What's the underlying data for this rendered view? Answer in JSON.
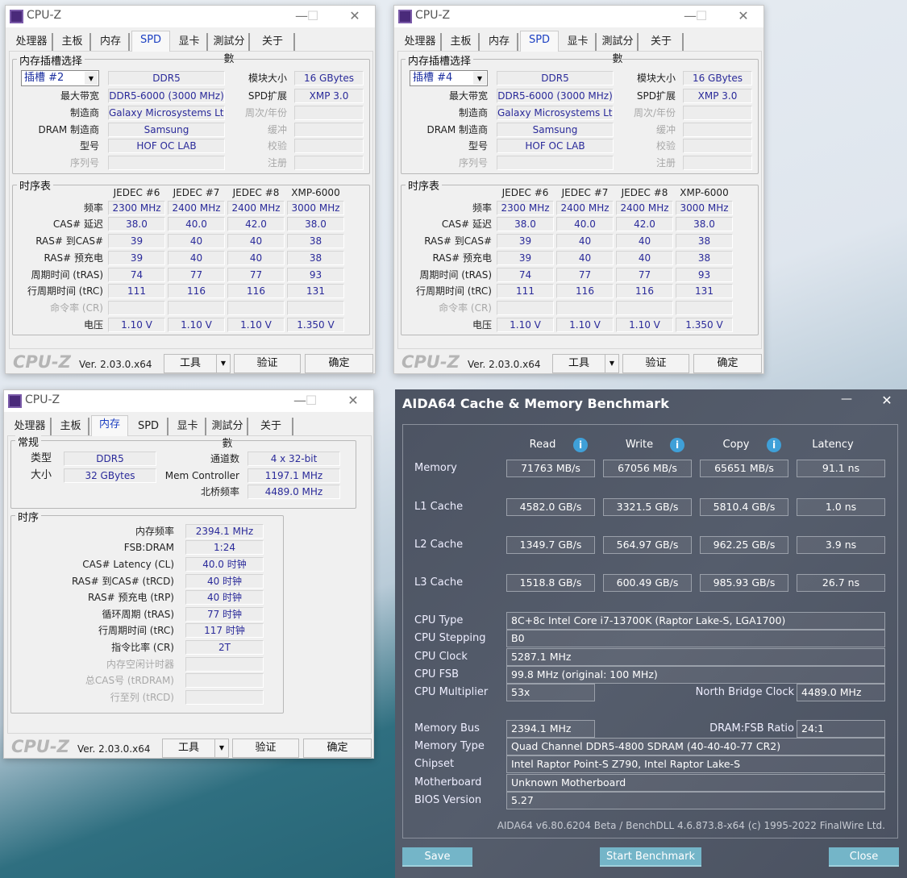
{
  "spd_windows": [
    {
      "title": "CPU-Z",
      "tabs": [
        "处理器",
        "主板",
        "内存",
        "SPD",
        "显卡",
        "測試分數",
        "关于"
      ],
      "active_tab": "SPD",
      "slot_group": "内存插槽选择",
      "slot": "插槽 #2",
      "left": [
        {
          "label": "",
          "value": "DDR5"
        },
        {
          "label": "最大带宽",
          "value": "DDR5-6000 (3000 MHz)"
        },
        {
          "label": "制造商",
          "value": "Galaxy Microsystems Ltd."
        },
        {
          "label": "DRAM 制造商",
          "value": "Samsung"
        },
        {
          "label": "型号",
          "value": "HOF OC LAB"
        },
        {
          "label": "序列号",
          "value": "",
          "disabled": true
        }
      ],
      "right": [
        {
          "label": "模块大小",
          "value": "16 GBytes"
        },
        {
          "label": "SPD扩展",
          "value": "XMP 3.0"
        },
        {
          "label": "周次/年份",
          "value": "",
          "disabled": true
        },
        {
          "label": "缓冲",
          "value": "",
          "disabled": true
        },
        {
          "label": "校验",
          "value": "",
          "disabled": true
        },
        {
          "label": "注册",
          "value": "",
          "disabled": true
        }
      ],
      "timing_group": "时序表",
      "timing_headers": [
        "JEDEC #6",
        "JEDEC #7",
        "JEDEC #8",
        "XMP-6000"
      ],
      "timing_rows": [
        {
          "label": "频率",
          "values": [
            "2300 MHz",
            "2400 MHz",
            "2400 MHz",
            "3000 MHz"
          ]
        },
        {
          "label": "CAS# 延迟",
          "values": [
            "38.0",
            "40.0",
            "42.0",
            "38.0"
          ]
        },
        {
          "label": "RAS# 到CAS#",
          "values": [
            "39",
            "40",
            "40",
            "38"
          ]
        },
        {
          "label": "RAS# 预充电",
          "values": [
            "39",
            "40",
            "40",
            "38"
          ]
        },
        {
          "label": "周期时间 (tRAS)",
          "values": [
            "74",
            "77",
            "77",
            "93"
          ]
        },
        {
          "label": "行周期时间 (tRC)",
          "values": [
            "111",
            "116",
            "116",
            "131"
          ]
        },
        {
          "label": "命令率 (CR)",
          "values": [
            "",
            "",
            "",
            ""
          ],
          "disabled": true
        },
        {
          "label": "电压",
          "values": [
            "1.10 V",
            "1.10 V",
            "1.10 V",
            "1.350 V"
          ]
        }
      ],
      "footer": {
        "logo": "CPU-Z",
        "version": "Ver. 2.03.0.x64",
        "tools": "工具",
        "validate": "验证",
        "ok": "确定"
      }
    },
    {
      "title": "CPU-Z",
      "tabs": [
        "处理器",
        "主板",
        "内存",
        "SPD",
        "显卡",
        "測試分數",
        "关于"
      ],
      "active_tab": "SPD",
      "slot_group": "内存插槽选择",
      "slot": "插槽 #4",
      "left": [
        {
          "label": "",
          "value": "DDR5"
        },
        {
          "label": "最大带宽",
          "value": "DDR5-6000 (3000 MHz)"
        },
        {
          "label": "制造商",
          "value": "Galaxy Microsystems Ltd."
        },
        {
          "label": "DRAM 制造商",
          "value": "Samsung"
        },
        {
          "label": "型号",
          "value": "HOF OC LAB"
        },
        {
          "label": "序列号",
          "value": "",
          "disabled": true
        }
      ],
      "right": [
        {
          "label": "模块大小",
          "value": "16 GBytes"
        },
        {
          "label": "SPD扩展",
          "value": "XMP 3.0"
        },
        {
          "label": "周次/年份",
          "value": "",
          "disabled": true
        },
        {
          "label": "缓冲",
          "value": "",
          "disabled": true
        },
        {
          "label": "校验",
          "value": "",
          "disabled": true
        },
        {
          "label": "注册",
          "value": "",
          "disabled": true
        }
      ],
      "timing_group": "时序表",
      "timing_headers": [
        "JEDEC #6",
        "JEDEC #7",
        "JEDEC #8",
        "XMP-6000"
      ],
      "timing_rows": [
        {
          "label": "频率",
          "values": [
            "2300 MHz",
            "2400 MHz",
            "2400 MHz",
            "3000 MHz"
          ]
        },
        {
          "label": "CAS# 延迟",
          "values": [
            "38.0",
            "40.0",
            "42.0",
            "38.0"
          ]
        },
        {
          "label": "RAS# 到CAS#",
          "values": [
            "39",
            "40",
            "40",
            "38"
          ]
        },
        {
          "label": "RAS# 预充电",
          "values": [
            "39",
            "40",
            "40",
            "38"
          ]
        },
        {
          "label": "周期时间 (tRAS)",
          "values": [
            "74",
            "77",
            "77",
            "93"
          ]
        },
        {
          "label": "行周期时间 (tRC)",
          "values": [
            "111",
            "116",
            "116",
            "131"
          ]
        },
        {
          "label": "命令率 (CR)",
          "values": [
            "",
            "",
            "",
            ""
          ],
          "disabled": true
        },
        {
          "label": "电压",
          "values": [
            "1.10 V",
            "1.10 V",
            "1.10 V",
            "1.350 V"
          ]
        }
      ],
      "footer": {
        "logo": "CPU-Z",
        "version": "Ver. 2.03.0.x64",
        "tools": "工具",
        "validate": "验证",
        "ok": "确定"
      }
    }
  ],
  "memory_window": {
    "title": "CPU-Z",
    "tabs": [
      "处理器",
      "主板",
      "内存",
      "SPD",
      "显卡",
      "測試分數",
      "关于"
    ],
    "active_tab": "内存",
    "general_group": "常规",
    "left": [
      {
        "label": "类型",
        "value": "DDR5"
      },
      {
        "label": "大小",
        "value": "32 GBytes"
      }
    ],
    "right": [
      {
        "label": "通道数",
        "value": "4 x 32-bit"
      },
      {
        "label": "Mem Controller",
        "value": "1197.1 MHz"
      },
      {
        "label": "北桥频率",
        "value": "4489.0 MHz"
      }
    ],
    "timing_group": "时序",
    "timings": [
      {
        "label": "内存频率",
        "value": "2394.1 MHz"
      },
      {
        "label": "FSB:DRAM",
        "value": "1:24"
      },
      {
        "label": "CAS# Latency (CL)",
        "value": "40.0 时钟"
      },
      {
        "label": "RAS# 到CAS# (tRCD)",
        "value": "40 时钟"
      },
      {
        "label": "RAS# 预充电 (tRP)",
        "value": "40 时钟"
      },
      {
        "label": "循环周期 (tRAS)",
        "value": "77 时钟"
      },
      {
        "label": "行周期时间 (tRC)",
        "value": "117 时钟"
      },
      {
        "label": "指令比率 (CR)",
        "value": "2T"
      },
      {
        "label": "内存空闲计时器",
        "value": "",
        "disabled": true
      },
      {
        "label": "总CAS号 (tRDRAM)",
        "value": "",
        "disabled": true
      },
      {
        "label": "行至列 (tRCD)",
        "value": "",
        "disabled": true
      }
    ],
    "footer": {
      "logo": "CPU-Z",
      "version": "Ver. 2.03.0.x64",
      "tools": "工具",
      "validate": "验证",
      "ok": "确定"
    }
  },
  "aida": {
    "title": "AIDA64 Cache & Memory Benchmark",
    "columns": [
      "Read",
      "Write",
      "Copy",
      "Latency"
    ],
    "bench_rows": [
      {
        "label": "Memory",
        "values": [
          "71763 MB/s",
          "67056 MB/s",
          "65651 MB/s",
          "91.1 ns"
        ]
      },
      {
        "label": "L1 Cache",
        "values": [
          "4582.0 GB/s",
          "3321.5 GB/s",
          "5810.4 GB/s",
          "1.0 ns"
        ]
      },
      {
        "label": "L2 Cache",
        "values": [
          "1349.7 GB/s",
          "564.97 GB/s",
          "962.25 GB/s",
          "3.9 ns"
        ]
      },
      {
        "label": "L3 Cache",
        "values": [
          "1518.8 GB/s",
          "600.49 GB/s",
          "985.93 GB/s",
          "26.7 ns"
        ]
      }
    ],
    "cpu_type": {
      "label": "CPU Type",
      "value": "8C+8c Intel Core i7-13700K  (Raptor Lake-S, LGA1700)"
    },
    "cpu_stepping": {
      "label": "CPU Stepping",
      "value": "B0"
    },
    "cpu_clock": {
      "label": "CPU Clock",
      "value": "5287.1 MHz"
    },
    "cpu_fsb": {
      "label": "CPU FSB",
      "value": "99.8 MHz  (original: 100 MHz)"
    },
    "cpu_multiplier": {
      "label": "CPU Multiplier",
      "value": "53x"
    },
    "nb_clock": {
      "label": "North Bridge Clock",
      "value": "4489.0 MHz"
    },
    "memory_bus": {
      "label": "Memory Bus",
      "value": "2394.1 MHz"
    },
    "dram_fsb": {
      "label": "DRAM:FSB Ratio",
      "value": "24:1"
    },
    "memory_type": {
      "label": "Memory Type",
      "value": "Quad Channel DDR5-4800 SDRAM  (40-40-40-77 CR2)"
    },
    "chipset": {
      "label": "Chipset",
      "value": "Intel Raptor Point-S Z790, Intel Raptor Lake-S"
    },
    "motherboard": {
      "label": "Motherboard",
      "value": "Unknown Motherboard"
    },
    "bios": {
      "label": "BIOS Version",
      "value": "5.27"
    },
    "footer_text": "AIDA64 v6.80.6204 Beta / BenchDLL 4.6.873.8-x64  (c) 1995-2022 FinalWire Ltd.",
    "buttons": {
      "save": "Save",
      "start": "Start Benchmark",
      "close": "Close"
    }
  }
}
